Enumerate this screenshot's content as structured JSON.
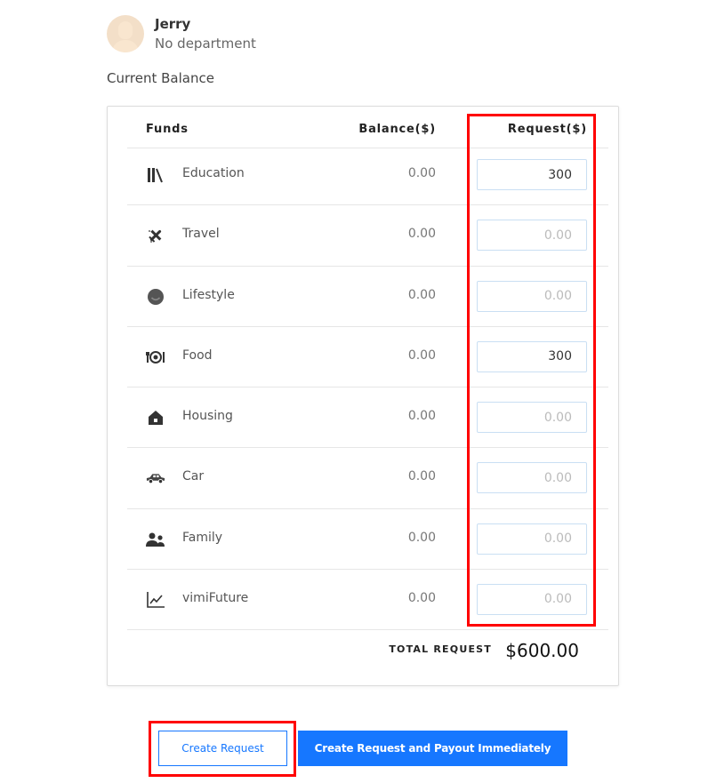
{
  "user": {
    "name": "Jerry",
    "department": "No department"
  },
  "section_title": "Current Balance",
  "table": {
    "headers": {
      "funds": "Funds",
      "balance": "Balance($)",
      "request": "Request($)"
    },
    "request_placeholder": "0.00",
    "rows": [
      {
        "icon": "books-icon",
        "label": "Education",
        "balance": "0.00",
        "request": "300"
      },
      {
        "icon": "plane-icon",
        "label": "Travel",
        "balance": "0.00",
        "request": ""
      },
      {
        "icon": "smile-icon",
        "label": "Lifestyle",
        "balance": "0.00",
        "request": ""
      },
      {
        "icon": "food-icon",
        "label": "Food",
        "balance": "0.00",
        "request": "300"
      },
      {
        "icon": "house-icon",
        "label": "Housing",
        "balance": "0.00",
        "request": ""
      },
      {
        "icon": "car-icon",
        "label": "Car",
        "balance": "0.00",
        "request": ""
      },
      {
        "icon": "family-icon",
        "label": "Family",
        "balance": "0.00",
        "request": ""
      },
      {
        "icon": "chart-icon",
        "label": "vimiFuture",
        "balance": "0.00",
        "request": ""
      }
    ],
    "total_label": "TOTAL REQUEST",
    "total_value": "$600.00"
  },
  "buttons": {
    "create": "Create Request",
    "create_payout": "Create Request and Payout Immediately"
  },
  "colors": {
    "primary": "#1677ff",
    "highlight": "#ff0000",
    "input_border": "#c9dff3"
  }
}
